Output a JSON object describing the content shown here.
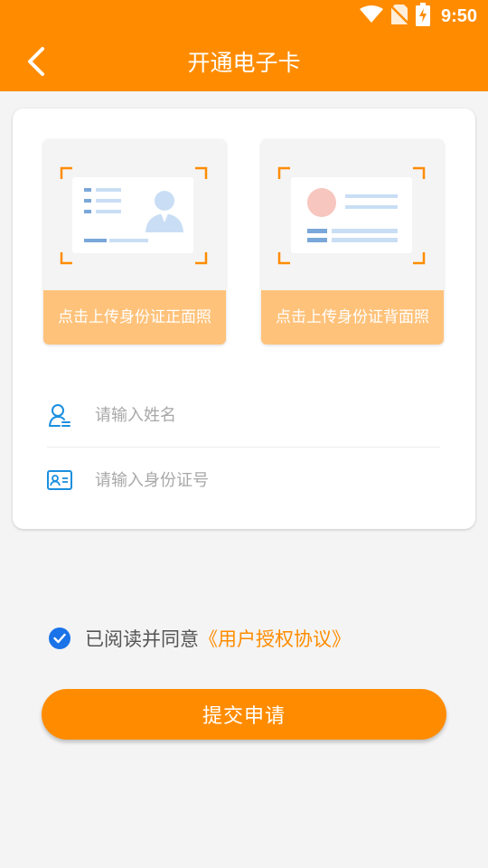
{
  "status_bar": {
    "time": "9:50",
    "icons": [
      "wifi-icon",
      "no-sim-icon",
      "battery-charging-icon"
    ]
  },
  "nav": {
    "back_icon": "chevron-left-icon",
    "title": "开通电子卡"
  },
  "upload": {
    "front_label": "点击上传身份证正面照",
    "back_label": "点击上传身份证背面照"
  },
  "form": {
    "name_placeholder": "请输入姓名",
    "name_value": "",
    "name_icon": "person-icon",
    "id_placeholder": "请输入身份证号",
    "id_value": "",
    "id_icon": "id-card-icon"
  },
  "agreement": {
    "checked": true,
    "text": "已阅读并同意",
    "link": "《用户授权协议》"
  },
  "submit": {
    "label": "提交申请"
  },
  "colors": {
    "brand": "#ff8c00",
    "tile_label_bg": "#ffc27a",
    "checkbox": "#1a73e8",
    "field_icon": "#1a8fe0"
  }
}
